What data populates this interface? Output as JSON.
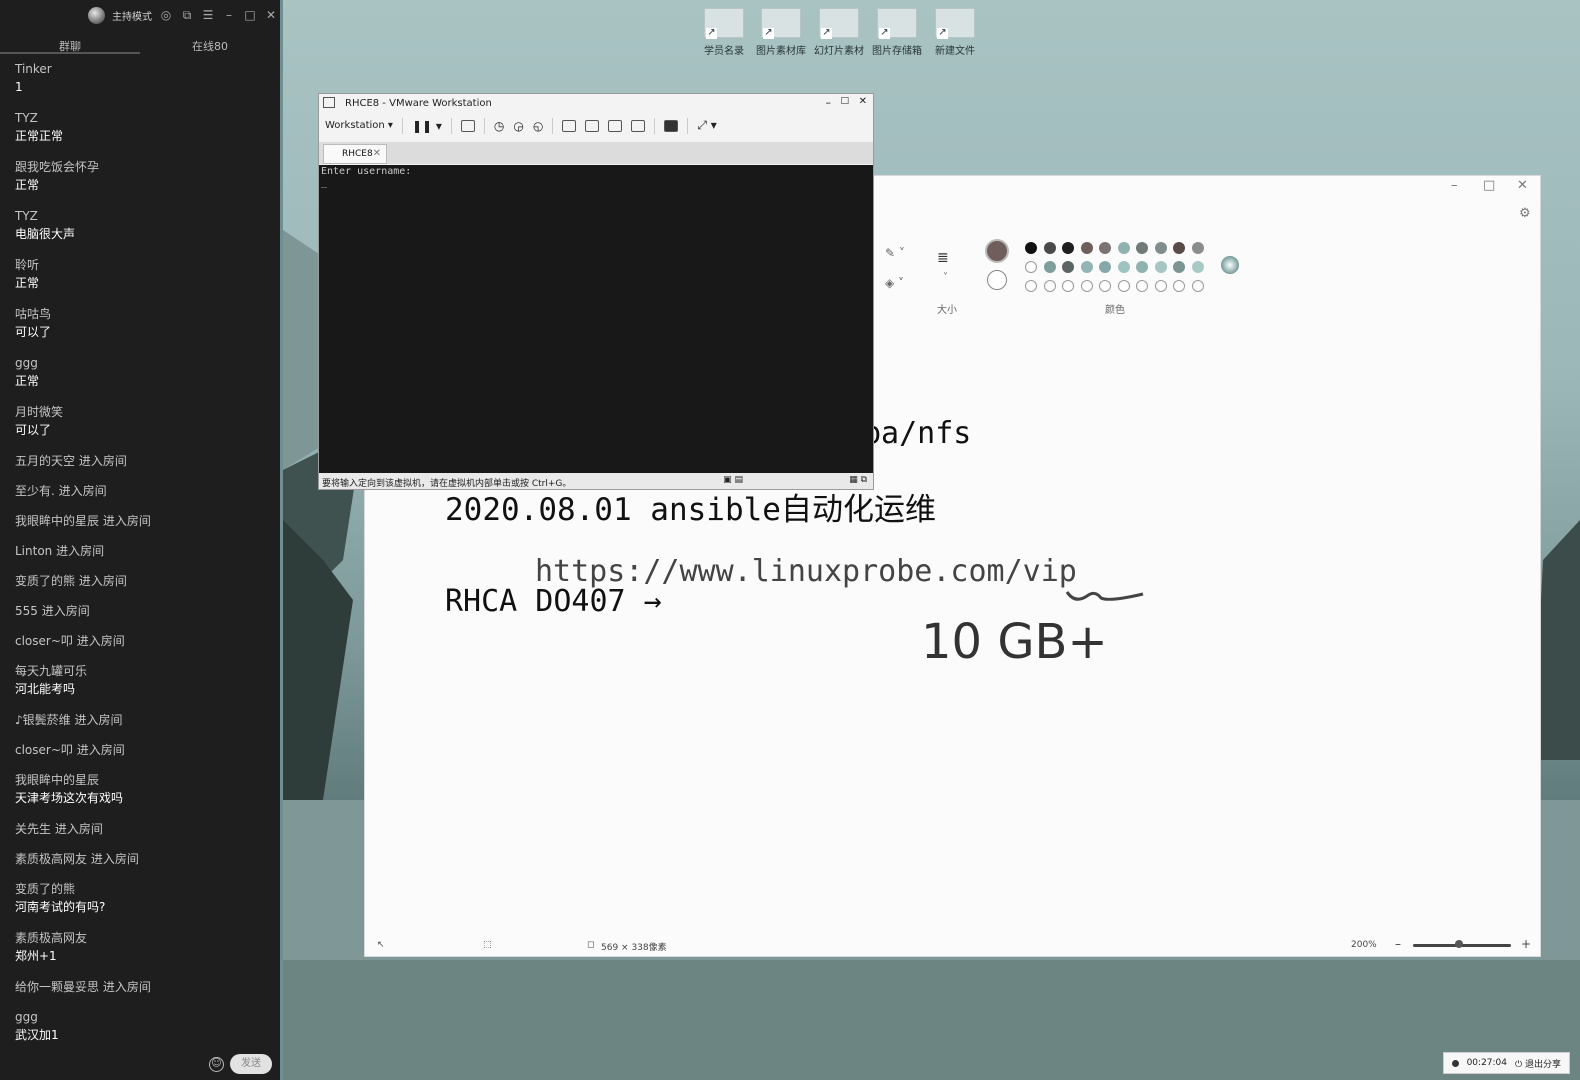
{
  "chat": {
    "mode_label": "主持模式",
    "tabs": [
      "群聊",
      "在线80"
    ],
    "messages": [
      {
        "user": "Tinker",
        "text": "1"
      },
      {
        "user": "TYZ",
        "text": "正常正常"
      },
      {
        "user": "跟我吃饭会怀孕",
        "text": "正常"
      },
      {
        "user": "TYZ",
        "text": "电脑很大声"
      },
      {
        "user": "聆听",
        "text": "正常"
      },
      {
        "user": "咕咕鸟",
        "text": "可以了"
      },
      {
        "user": "ggg",
        "text": "正常"
      },
      {
        "user": "月时微笑",
        "text": "可以了"
      }
    ],
    "joins": [
      "五月的天空 进入房间",
      "至少有. 进入房间",
      "我眼眸中的星辰 进入房间",
      "Linton 进入房间",
      "变质了的熊 进入房间",
      "555 进入房间",
      "closer~叩   进入房间"
    ],
    "messages2": [
      {
        "user": "每天九罐可乐",
        "text": "河北能考吗"
      }
    ],
    "joins2": [
      "♪银鬓菸维 进入房间",
      "closer~叩   进入房间"
    ],
    "messages3": [
      {
        "user": "我眼眸中的星辰",
        "text": "天津考场这次有戏吗"
      }
    ],
    "joins3": [
      "关先生 进入房间",
      "素质极高网友 进入房间"
    ],
    "messages4": [
      {
        "user": "变质了的熊",
        "text": "河南考试的有吗?"
      },
      {
        "user": "素质极高网友",
        "text": "郑州+1"
      }
    ],
    "joins4": [
      "给你一颗曼妥思 进入房间"
    ],
    "messages5": [
      {
        "user": "ggg",
        "text": "武汉加1"
      }
    ],
    "send_label": "发送"
  },
  "desktop_icons": [
    "学员名录",
    "图片素材库",
    "幻灯片素材",
    "图片存储箱",
    "新建文件"
  ],
  "vmware": {
    "title": "RHCE8 - VMware Workstation",
    "menu_label": "Workstation",
    "tab_label": "RHCE8",
    "console_line": "Enter username:",
    "cursor": "_",
    "status_text": "要将输入定向到该虚拟机，请在虚拟机内部单击或按 Ctrl+G。"
  },
  "paint": {
    "size_label": "大小",
    "colors_label": "颜色",
    "canvas_lines": [
      "ba/nfs",
      "2020.08.01 ansible自动化运维",
      "https://www.linuxprobe.com/vip",
      "RHCA DO407 →"
    ],
    "handwriting": "10 GB+",
    "status_dimensions": "569 × 338像素",
    "zoom": "200%",
    "palette_row1": [
      "#111111",
      "#4a4a4a",
      "#1f1f1f",
      "#6f5e5c",
      "#7c7272",
      "#8fb3b1",
      "#6f7a79",
      "#7f8e8c",
      "#5a4a48",
      "#8a8e8c"
    ],
    "palette_row2": [
      "#ffffff",
      "#7f9f9d",
      "#5c6564",
      "#93b5b3",
      "#86a9a7",
      "#9fc3c1",
      "#8fb2b0",
      "#a6c6c4",
      "#7b9593",
      "#a9c9c7"
    ],
    "current_color": "#6f5e5c"
  },
  "recording": {
    "time": "00:27:04",
    "exit_label": "退出分享"
  }
}
